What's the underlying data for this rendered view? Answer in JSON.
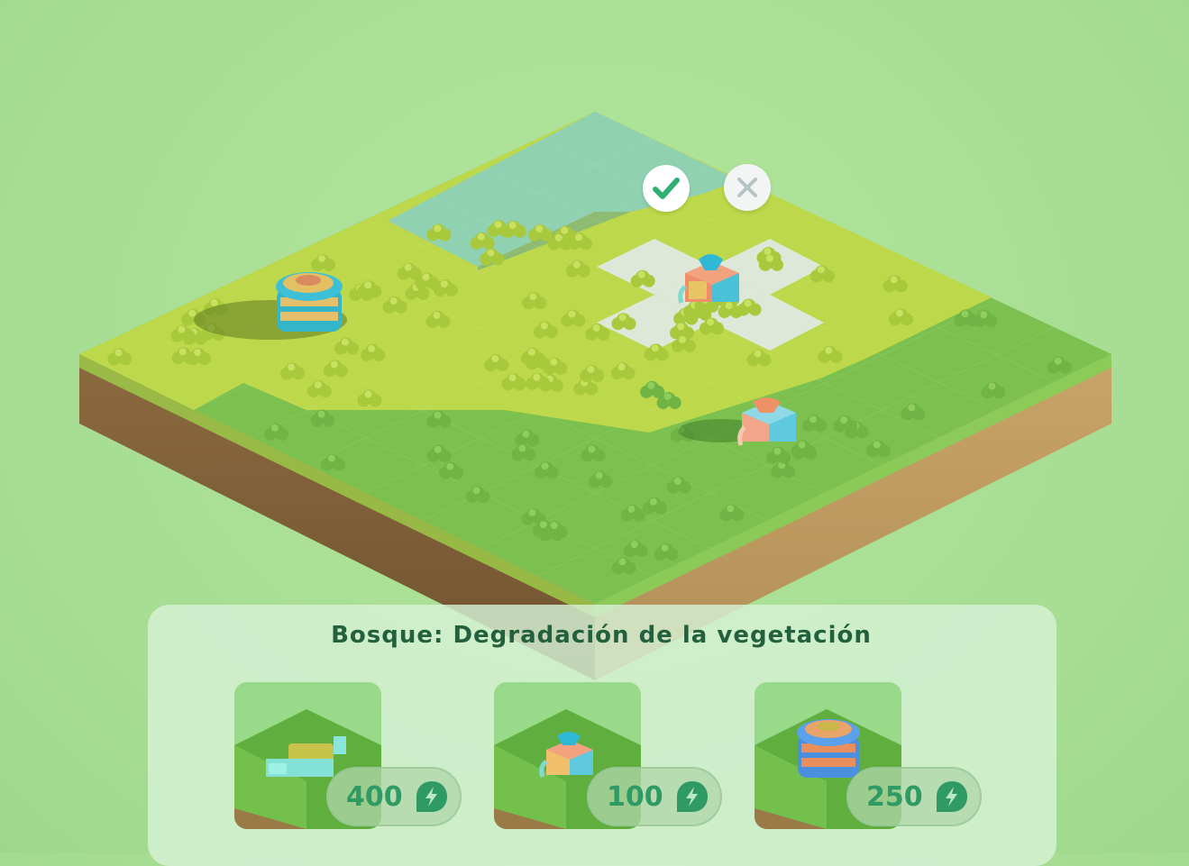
{
  "game": {
    "title": "Bosque: Degradación de la vegetación",
    "confirm_icon": "check-icon",
    "cancel_icon": "close-icon",
    "currency_icon": "leaf-energy-icon",
    "colors": {
      "accent": "#2f9a63",
      "title": "#23613e",
      "confirm_check": "#2fb072",
      "cancel_x": "#b5c4c4"
    },
    "cards": [
      {
        "name": "solar-collector",
        "cost": "400"
      },
      {
        "name": "water-pump",
        "cost": "100"
      },
      {
        "name": "storage-silo",
        "cost": "250"
      }
    ]
  }
}
